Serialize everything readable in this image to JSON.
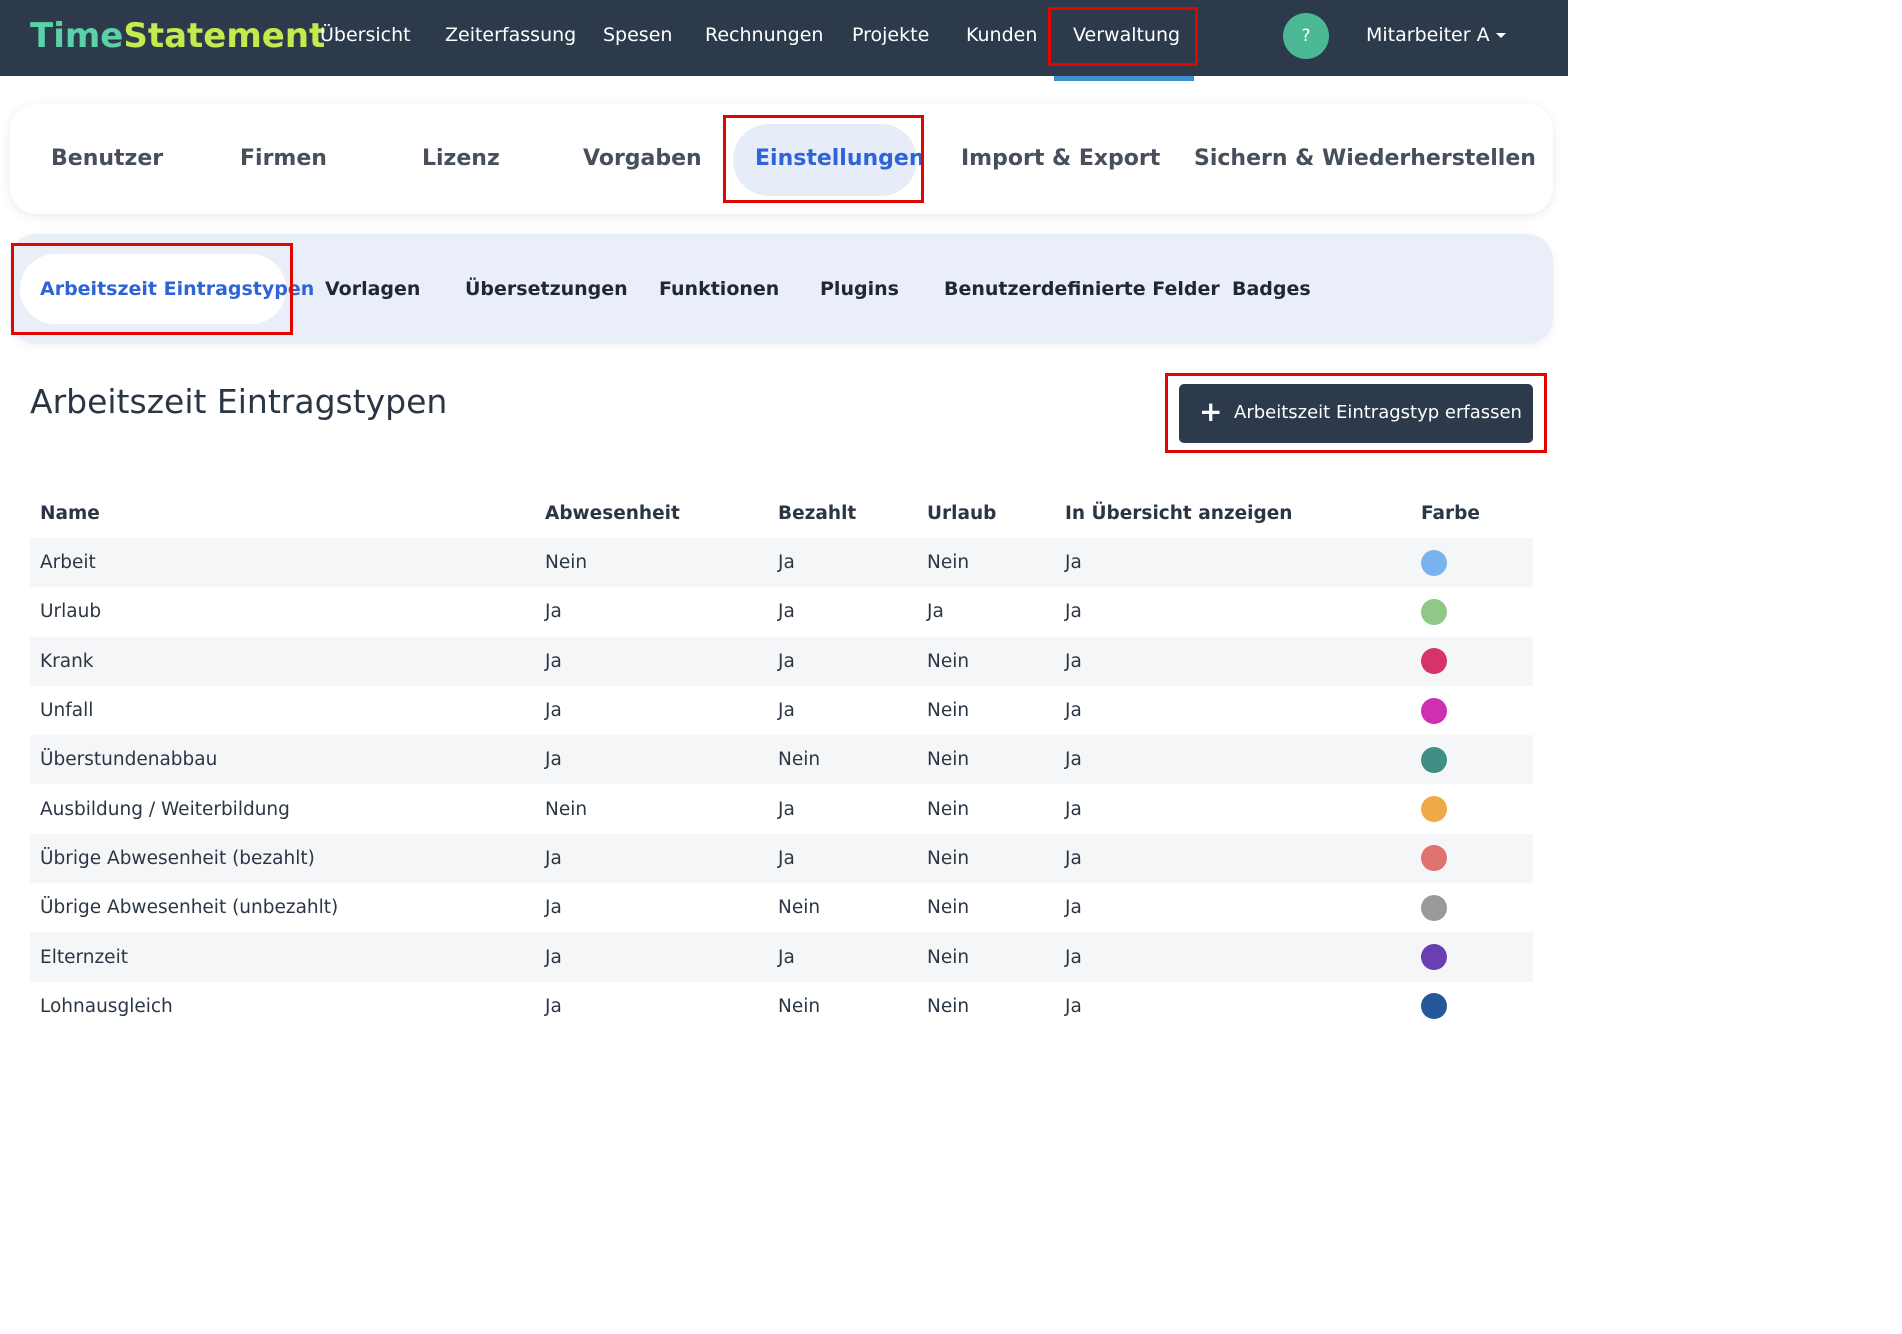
{
  "app": {
    "logo_part1": "Time",
    "logo_part2": "Statement"
  },
  "topnav": {
    "items": [
      {
        "label": "Übersicht"
      },
      {
        "label": "Zeiterfassung"
      },
      {
        "label": "Spesen"
      },
      {
        "label": "Rechnungen"
      },
      {
        "label": "Projekte"
      },
      {
        "label": "Kunden"
      },
      {
        "label": "Verwaltung",
        "active": true
      }
    ],
    "help_label": "?",
    "user_label": "Mitarbeiter A"
  },
  "admin_tabs": {
    "items": [
      {
        "label": "Benutzer"
      },
      {
        "label": "Firmen"
      },
      {
        "label": "Lizenz"
      },
      {
        "label": "Vorgaben"
      },
      {
        "label": "Einstellungen",
        "active": true
      },
      {
        "label": "Import & Export"
      },
      {
        "label": "Sichern & Wiederherstellen"
      }
    ]
  },
  "settings_tabs": {
    "items": [
      {
        "label": "Arbeitszeit Eintragstypen",
        "active": true
      },
      {
        "label": "Vorlagen"
      },
      {
        "label": "Übersetzungen"
      },
      {
        "label": "Funktionen"
      },
      {
        "label": "Plugins"
      },
      {
        "label": "Benutzerdefinierte Felder"
      },
      {
        "label": "Badges"
      }
    ]
  },
  "page": {
    "title": "Arbeitszeit Eintragstypen",
    "add_button_label": "Arbeitszeit Eintragstyp erfassen",
    "add_button_icon": "plus-icon"
  },
  "table": {
    "columns": [
      "Name",
      "Abwesenheit",
      "Bezahlt",
      "Urlaub",
      "In Übersicht anzeigen",
      "Farbe"
    ],
    "rows": [
      {
        "name": "Arbeit",
        "abwesenheit": "Nein",
        "bezahlt": "Ja",
        "urlaub": "Nein",
        "uebersicht": "Ja",
        "farbe": "#7ab4ee"
      },
      {
        "name": "Urlaub",
        "abwesenheit": "Ja",
        "bezahlt": "Ja",
        "urlaub": "Ja",
        "uebersicht": "Ja",
        "farbe": "#8fc985"
      },
      {
        "name": "Krank",
        "abwesenheit": "Ja",
        "bezahlt": "Ja",
        "urlaub": "Nein",
        "uebersicht": "Ja",
        "farbe": "#d5336a"
      },
      {
        "name": "Unfall",
        "abwesenheit": "Ja",
        "bezahlt": "Ja",
        "urlaub": "Nein",
        "uebersicht": "Ja",
        "farbe": "#cf2fb2"
      },
      {
        "name": "Überstundenabbau",
        "abwesenheit": "Ja",
        "bezahlt": "Nein",
        "urlaub": "Nein",
        "uebersicht": "Ja",
        "farbe": "#408f85"
      },
      {
        "name": "Ausbildung / Weiterbildung",
        "abwesenheit": "Nein",
        "bezahlt": "Ja",
        "urlaub": "Nein",
        "uebersicht": "Ja",
        "farbe": "#efaa48"
      },
      {
        "name": "Übrige Abwesenheit (bezahlt)",
        "abwesenheit": "Ja",
        "bezahlt": "Ja",
        "urlaub": "Nein",
        "uebersicht": "Ja",
        "farbe": "#de736f"
      },
      {
        "name": "Übrige Abwesenheit (unbezahlt)",
        "abwesenheit": "Ja",
        "bezahlt": "Nein",
        "urlaub": "Nein",
        "uebersicht": "Ja",
        "farbe": "#9a9a9a"
      },
      {
        "name": "Elternzeit",
        "abwesenheit": "Ja",
        "bezahlt": "Ja",
        "urlaub": "Nein",
        "uebersicht": "Ja",
        "farbe": "#6a3fb3"
      },
      {
        "name": "Lohnausgleich",
        "abwesenheit": "Ja",
        "bezahlt": "Nein",
        "urlaub": "Nein",
        "uebersicht": "Ja",
        "farbe": "#25589b"
      }
    ]
  },
  "colors": {
    "navbar_bg": "#2d3a4b",
    "active_tab_text": "#2e64d6",
    "highlight_border": "#e10600",
    "help_bg": "#4cb896"
  }
}
